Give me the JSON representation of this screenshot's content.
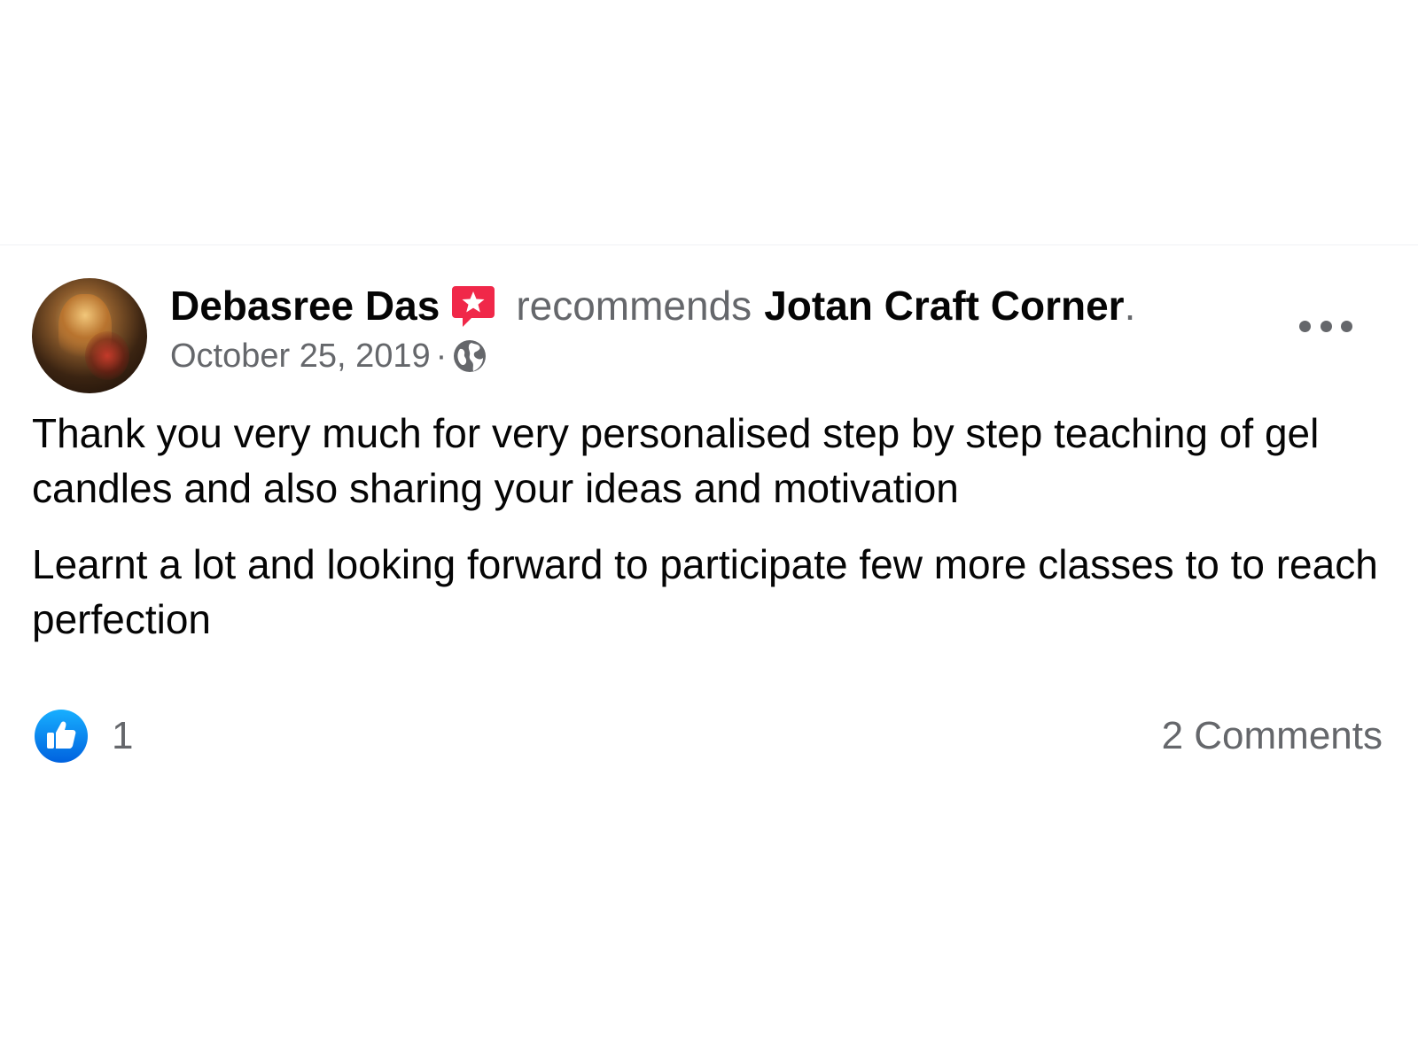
{
  "post": {
    "author": "Debasree Das",
    "action": "recommends",
    "page_name": "Jotan Craft Corner",
    "punctuation": ".",
    "date": "October 25, 2019",
    "separator": "·",
    "privacy_icon": "globe-icon",
    "badge_icon": "recommendation-badge-icon",
    "more_icon": "more-options-icon",
    "paragraphs": [
      "Thank you very much for very personalised step by step teaching of gel candles and also sharing your ideas and motivation",
      "Learnt a lot and looking forward to participate few more classes to to reach perfection"
    ]
  },
  "footer": {
    "like_icon": "like-icon",
    "like_count": "1",
    "comments_label": "2 Comments"
  },
  "colors": {
    "like_blue": "#1877f2",
    "badge_red": "#f02849",
    "secondary_text": "#65676b",
    "primary_text": "#050505"
  }
}
